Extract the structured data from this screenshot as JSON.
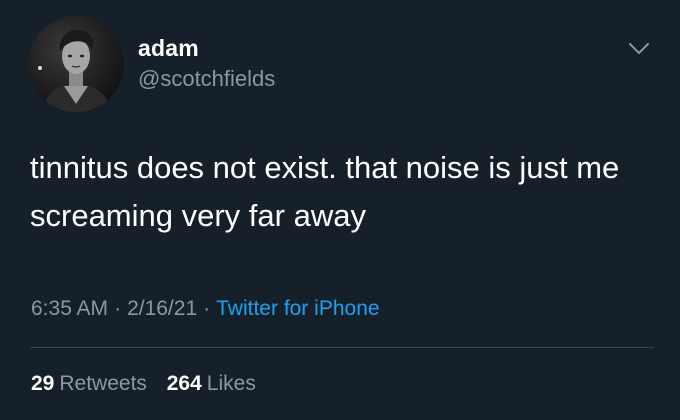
{
  "user": {
    "display_name": "adam",
    "handle": "@scotchfields"
  },
  "tweet": {
    "text": "tinnitus does not exist. that noise is just me screaming very far away",
    "time": "6:35 AM",
    "date": "2/16/21",
    "separator": "·",
    "source": "Twitter for iPhone"
  },
  "stats": {
    "retweets": {
      "count": "29",
      "label": "Retweets"
    },
    "likes": {
      "count": "264",
      "label": "Likes"
    }
  },
  "icons": {
    "menu": "chevron-down-icon"
  },
  "colors": {
    "background": "#15202b",
    "primary_text": "#ffffff",
    "secondary_text": "#8899a6",
    "link": "#1da1f2",
    "divider": "#38444d"
  }
}
